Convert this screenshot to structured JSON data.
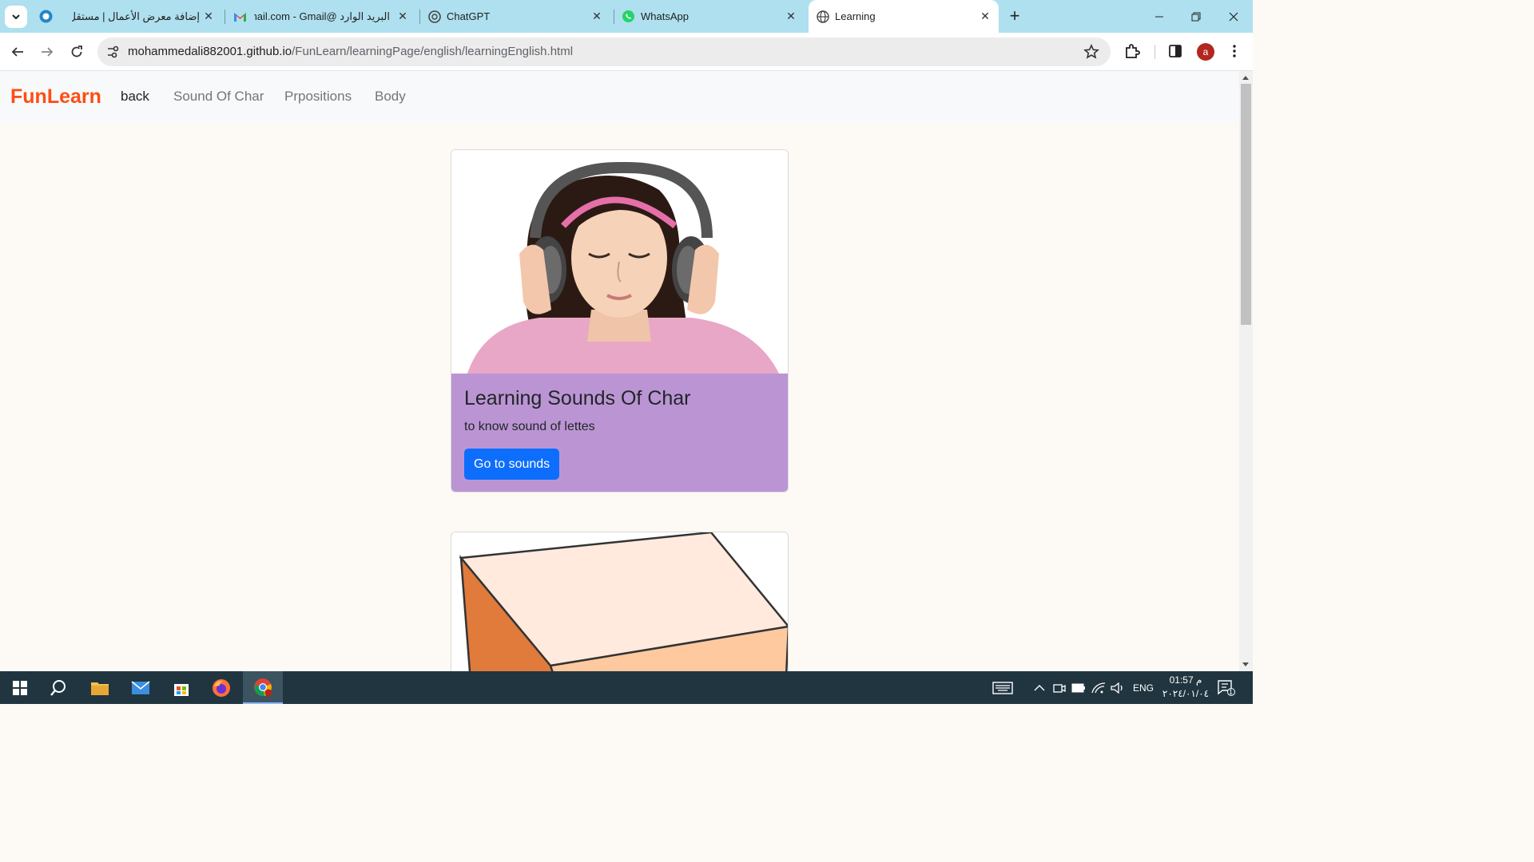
{
  "browser": {
    "tabs": [
      {
        "title": "إضافة معرض الأعمال | مستقل",
        "icon": "mostaql-icon"
      },
      {
        "title": "البريد الوارد - Gmail",
        "icon": "gmail-icon",
        "prefix": "@gmail.com - Gmail",
        "full": "البريد الوارد @gmail.com - Gmail"
      },
      {
        "title": "ChatGPT",
        "icon": "chatgpt-icon"
      },
      {
        "title": "WhatsApp",
        "icon": "whatsapp-icon"
      },
      {
        "title": "Learning",
        "icon": "globe-icon"
      }
    ],
    "url_host": "mohammedali882001.github.io",
    "url_path": "/FunLearn/learningPage/english/learningEnglish.html",
    "profile_initial": "a"
  },
  "site": {
    "brand": "FunLearn",
    "nav": [
      "back",
      "Sound Of Char",
      "Prpositions",
      "Body"
    ]
  },
  "cards": [
    {
      "title": "Learning Sounds Of Char",
      "text": "to know sound of lettes",
      "button": "Go to sounds",
      "color": "#bb95d3"
    }
  ],
  "taskbar": {
    "lang": "ENG",
    "time": "01:57 م",
    "date": "٢٠٢٤/٠١/٠٤",
    "notifications": "1"
  },
  "colors": {
    "brand": "#fd4d14",
    "primary_button": "#0d6efd",
    "tabstrip": "#aee0ef",
    "taskbar": "#203540"
  }
}
